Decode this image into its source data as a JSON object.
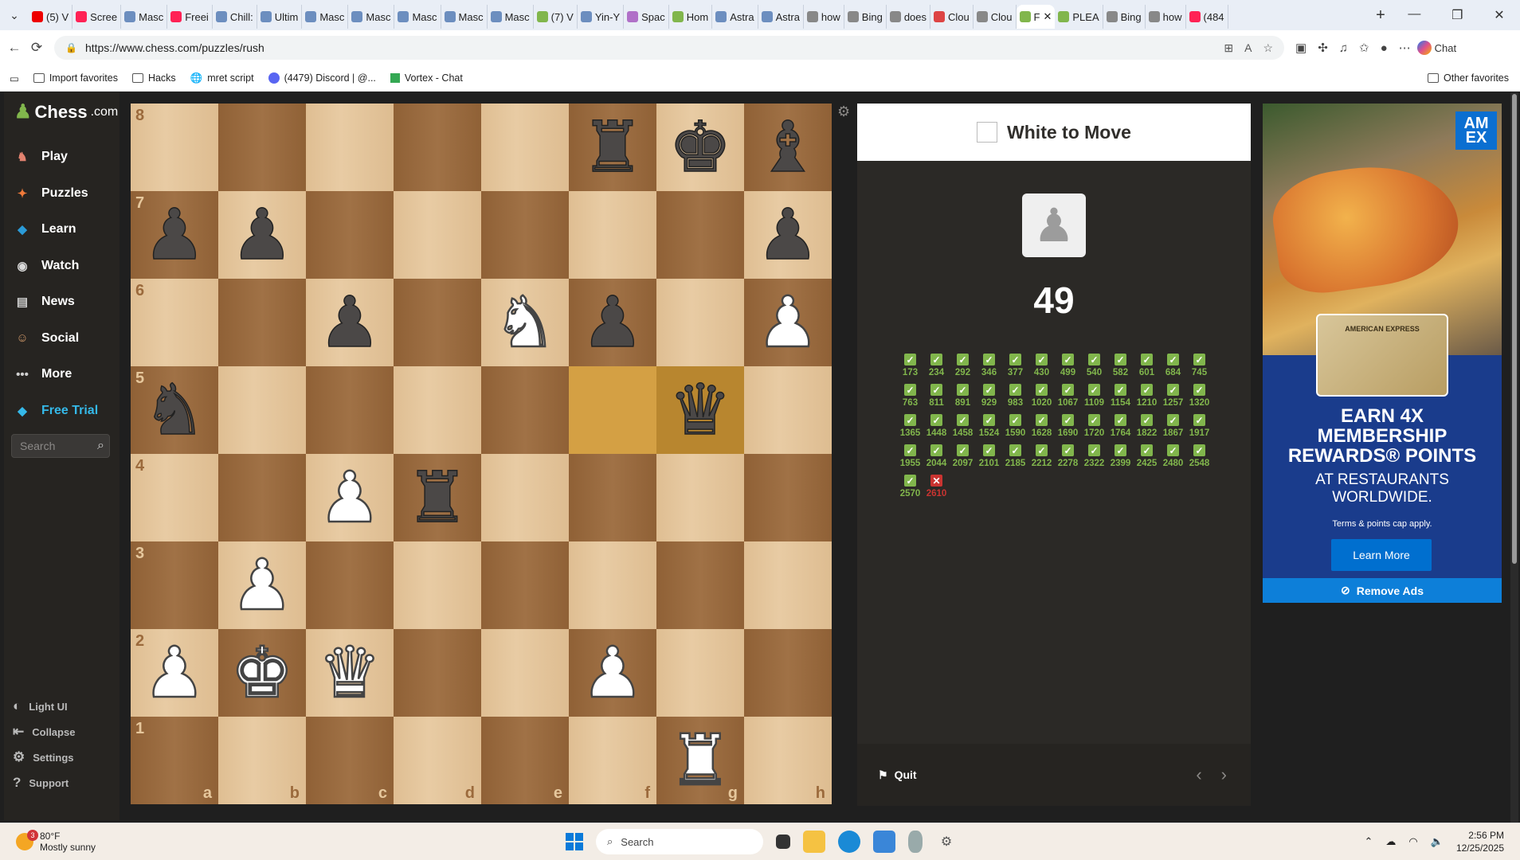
{
  "browser": {
    "tabs": [
      {
        "label": "(5) V",
        "color": "#e00"
      },
      {
        "label": "Scree",
        "color": "#f25"
      },
      {
        "label": "Masc",
        "color": "#6c8ebf"
      },
      {
        "label": "Freei",
        "color": "#f25"
      },
      {
        "label": "Chill:",
        "color": "#6c8ebf"
      },
      {
        "label": "Ultim",
        "color": "#6c8ebf"
      },
      {
        "label": "Masc",
        "color": "#6c8ebf"
      },
      {
        "label": "Masc",
        "color": "#6c8ebf"
      },
      {
        "label": "Masc",
        "color": "#6c8ebf"
      },
      {
        "label": "Masc",
        "color": "#6c8ebf"
      },
      {
        "label": "Masc",
        "color": "#6c8ebf"
      },
      {
        "label": "(7) V",
        "color": "#81b64c"
      },
      {
        "label": "Yin-Y",
        "color": "#6c8ebf"
      },
      {
        "label": "Spac",
        "color": "#b070c8"
      },
      {
        "label": "Hom",
        "color": "#81b64c"
      },
      {
        "label": "Astra",
        "color": "#6c8ebf"
      },
      {
        "label": "Astra",
        "color": "#6c8ebf"
      },
      {
        "label": "how",
        "color": "#888"
      },
      {
        "label": "Bing",
        "color": "#888"
      },
      {
        "label": "does",
        "color": "#888"
      },
      {
        "label": "Clou",
        "color": "#d44"
      },
      {
        "label": "Clou",
        "color": "#888"
      }
    ],
    "active_tab": {
      "label": "F",
      "color": "#81b64c"
    },
    "after_tabs": [
      {
        "label": "PLEA",
        "color": "#81b64c"
      },
      {
        "label": "Bing",
        "color": "#888"
      },
      {
        "label": "how",
        "color": "#888"
      },
      {
        "label": "(484",
        "color": "#f25"
      }
    ],
    "url": "https://www.chess.com/puzzles/rush",
    "chat_label": "Chat",
    "favorites": [
      {
        "label": "Import favorites"
      },
      {
        "label": "Hacks"
      },
      {
        "label": "mret script"
      },
      {
        "label": "(4479) Discord | @..."
      },
      {
        "label": "Vortex - Chat"
      }
    ],
    "other_favorites": "Other favorites"
  },
  "sidebar": {
    "logo_main": "Chess",
    "logo_suffix": ".com",
    "nav": [
      {
        "label": "Play",
        "icon": "play-icon",
        "color": "#e2826f"
      },
      {
        "label": "Puzzles",
        "icon": "puzzles-icon",
        "color": "#f07a3a"
      },
      {
        "label": "Learn",
        "icon": "learn-icon",
        "color": "#2b9bd8"
      },
      {
        "label": "Watch",
        "icon": "watch-icon",
        "color": "#dadada"
      },
      {
        "label": "News",
        "icon": "news-icon",
        "color": "#cfcfcf"
      },
      {
        "label": "Social",
        "icon": "social-icon",
        "color": "#d49b6a"
      },
      {
        "label": "More",
        "icon": "more-icon",
        "color": "#cfcfcf"
      },
      {
        "label": "Free Trial",
        "icon": "diamond-icon",
        "color": "#35b9e9"
      }
    ],
    "search_placeholder": "Search",
    "bottom": [
      {
        "label": "Light UI"
      },
      {
        "label": "Collapse"
      },
      {
        "label": "Settings"
      },
      {
        "label": "Support"
      }
    ]
  },
  "board": {
    "ranks": [
      "8",
      "7",
      "6",
      "5",
      "4",
      "3",
      "2",
      "1"
    ],
    "files": [
      "a",
      "b",
      "c",
      "d",
      "e",
      "f",
      "g",
      "h"
    ],
    "highlight_squares": [
      "f5",
      "g5"
    ],
    "pieces": [
      {
        "sq": "f8",
        "p": "r",
        "c": "b"
      },
      {
        "sq": "g8",
        "p": "k",
        "c": "b"
      },
      {
        "sq": "h8",
        "p": "b",
        "c": "b"
      },
      {
        "sq": "a7",
        "p": "p",
        "c": "b"
      },
      {
        "sq": "b7",
        "p": "p",
        "c": "b"
      },
      {
        "sq": "h7",
        "p": "p",
        "c": "b"
      },
      {
        "sq": "c6",
        "p": "p",
        "c": "b"
      },
      {
        "sq": "e6",
        "p": "n",
        "c": "w"
      },
      {
        "sq": "f6",
        "p": "p",
        "c": "b"
      },
      {
        "sq": "h6",
        "p": "p",
        "c": "w"
      },
      {
        "sq": "a5",
        "p": "n",
        "c": "b"
      },
      {
        "sq": "g5",
        "p": "q",
        "c": "b"
      },
      {
        "sq": "c4",
        "p": "p",
        "c": "w"
      },
      {
        "sq": "d4",
        "p": "r",
        "c": "b"
      },
      {
        "sq": "b3",
        "p": "p",
        "c": "w"
      },
      {
        "sq": "a2",
        "p": "p",
        "c": "w"
      },
      {
        "sq": "b2",
        "p": "k",
        "c": "w"
      },
      {
        "sq": "c2",
        "p": "q",
        "c": "w"
      },
      {
        "sq": "f2",
        "p": "p",
        "c": "w"
      },
      {
        "sq": "g1",
        "p": "r",
        "c": "w"
      }
    ]
  },
  "puzzle": {
    "to_move": "White to Move",
    "score": "49",
    "results": [
      {
        "v": "173",
        "ok": true
      },
      {
        "v": "234",
        "ok": true
      },
      {
        "v": "292",
        "ok": true
      },
      {
        "v": "346",
        "ok": true
      },
      {
        "v": "377",
        "ok": true
      },
      {
        "v": "430",
        "ok": true
      },
      {
        "v": "499",
        "ok": true
      },
      {
        "v": "540",
        "ok": true
      },
      {
        "v": "582",
        "ok": true
      },
      {
        "v": "601",
        "ok": true
      },
      {
        "v": "684",
        "ok": true
      },
      {
        "v": "745",
        "ok": true
      },
      {
        "v": "763",
        "ok": true
      },
      {
        "v": "811",
        "ok": true
      },
      {
        "v": "891",
        "ok": true
      },
      {
        "v": "929",
        "ok": true
      },
      {
        "v": "983",
        "ok": true
      },
      {
        "v": "1020",
        "ok": true
      },
      {
        "v": "1067",
        "ok": true
      },
      {
        "v": "1109",
        "ok": true
      },
      {
        "v": "1154",
        "ok": true
      },
      {
        "v": "1210",
        "ok": true
      },
      {
        "v": "1257",
        "ok": true
      },
      {
        "v": "1320",
        "ok": true
      },
      {
        "v": "1365",
        "ok": true
      },
      {
        "v": "1448",
        "ok": true
      },
      {
        "v": "1458",
        "ok": true
      },
      {
        "v": "1524",
        "ok": true
      },
      {
        "v": "1590",
        "ok": true
      },
      {
        "v": "1628",
        "ok": true
      },
      {
        "v": "1690",
        "ok": true
      },
      {
        "v": "1720",
        "ok": true
      },
      {
        "v": "1764",
        "ok": true
      },
      {
        "v": "1822",
        "ok": true
      },
      {
        "v": "1867",
        "ok": true
      },
      {
        "v": "1917",
        "ok": true
      },
      {
        "v": "1955",
        "ok": true
      },
      {
        "v": "2044",
        "ok": true
      },
      {
        "v": "2097",
        "ok": true
      },
      {
        "v": "2101",
        "ok": true
      },
      {
        "v": "2185",
        "ok": true
      },
      {
        "v": "2212",
        "ok": true
      },
      {
        "v": "2278",
        "ok": true
      },
      {
        "v": "2322",
        "ok": true
      },
      {
        "v": "2399",
        "ok": true
      },
      {
        "v": "2425",
        "ok": true
      },
      {
        "v": "2480",
        "ok": true
      },
      {
        "v": "2548",
        "ok": true
      },
      {
        "v": "2570",
        "ok": true
      },
      {
        "v": "2610",
        "ok": false
      }
    ],
    "quit_label": "Quit"
  },
  "ad": {
    "logo": "AM EX",
    "card_text": "AMERICAN EXPRESS",
    "headline_1": "EARN 4X",
    "headline_2": "MEMBERSHIP",
    "headline_3": "REWARDS® POINTS",
    "sub_1": "AT RESTAURANTS",
    "sub_2": "WORLDWIDE.",
    "terms": "Terms & points cap apply.",
    "cta": "Learn More",
    "remove_ads": "Remove Ads"
  },
  "taskbar": {
    "weather_temp": "80°F",
    "weather_desc": "Mostly sunny",
    "weather_badge": "3",
    "search_label": "Search",
    "time": "2:56 PM",
    "date": "12/25/2025"
  }
}
